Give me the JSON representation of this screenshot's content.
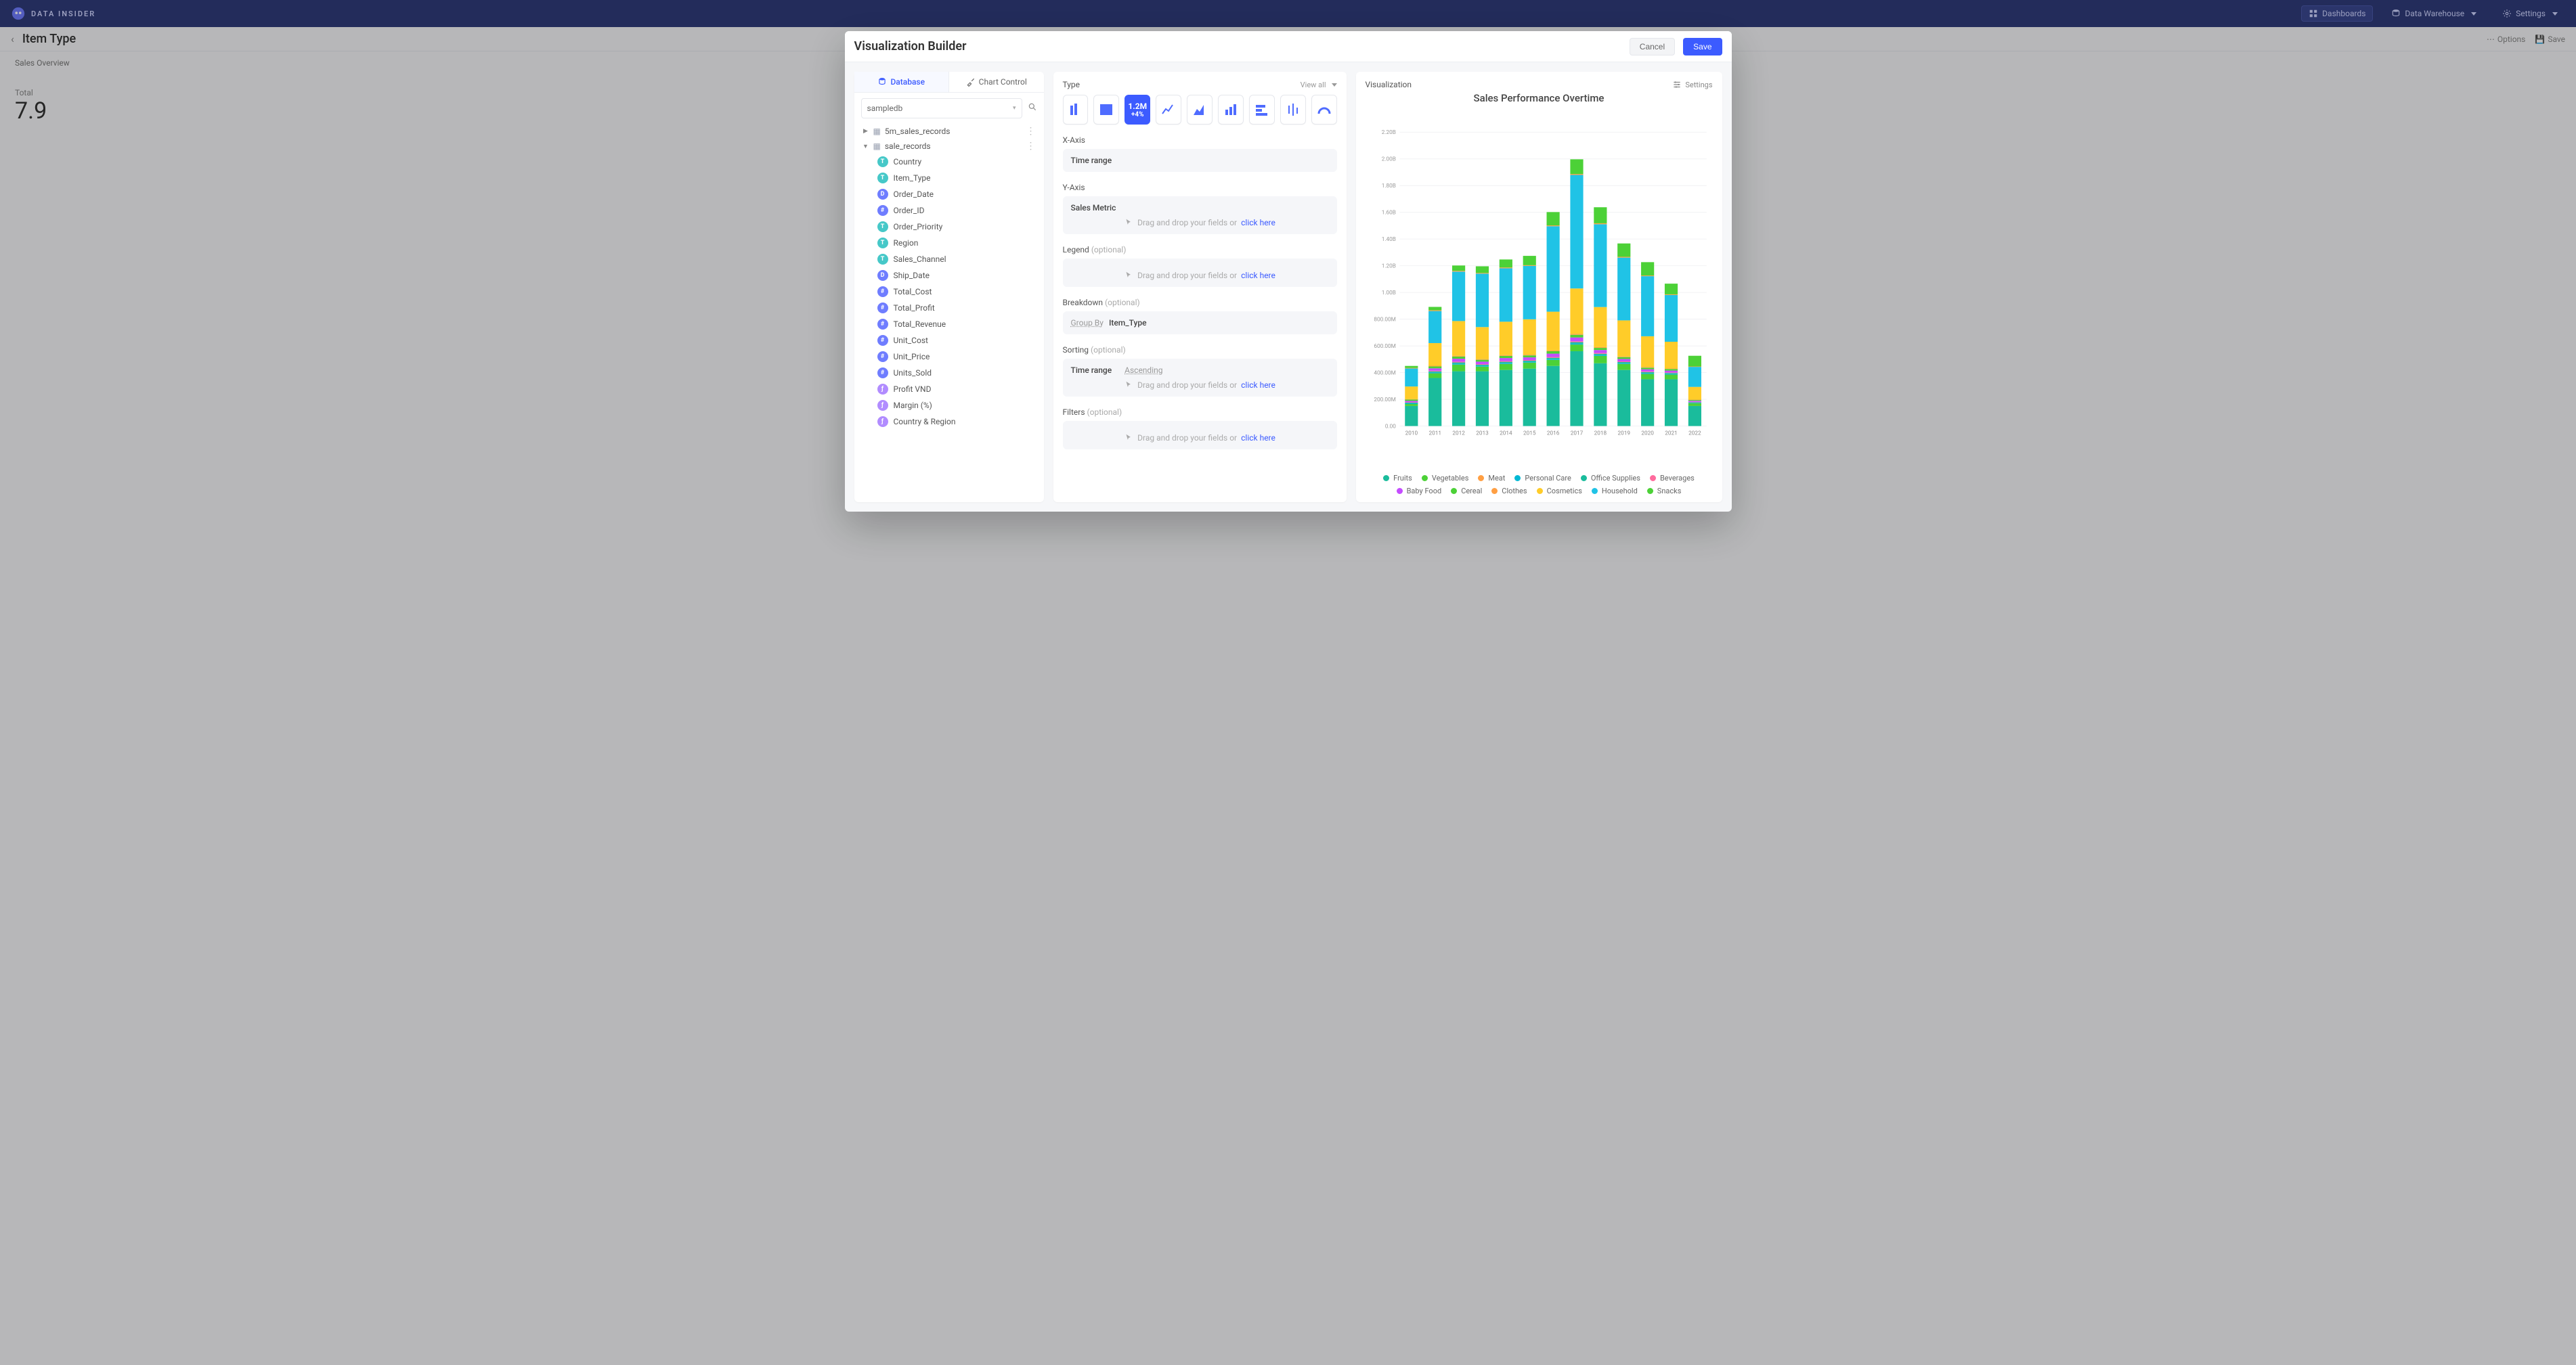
{
  "app": {
    "brand": "DATA INSIDER",
    "header_buttons": {
      "dashboards": "Dashboards",
      "warehouse": "Data Warehouse",
      "settings": "Settings"
    }
  },
  "page": {
    "back_breadcrumb": "Item Type",
    "tools": {
      "options": "Options",
      "save": "Save"
    },
    "side_tab": "Sales Overview",
    "bg_number_label": "Total",
    "bg_number": "7.9"
  },
  "modal": {
    "title": "Visualization Builder",
    "cancel": "Cancel",
    "save": "Save"
  },
  "left_panel": {
    "tabs": {
      "database": "Database",
      "chart_control": "Chart Control"
    },
    "db_selected": "sampledb",
    "tables": [
      {
        "id": "5m",
        "name": "5m_sales_records",
        "expanded": false
      },
      {
        "id": "sr",
        "name": "sale_records",
        "expanded": true
      }
    ],
    "columns": [
      {
        "type": "T",
        "name": "Country"
      },
      {
        "type": "T",
        "name": "Item_Type"
      },
      {
        "type": "D",
        "name": "Order_Date"
      },
      {
        "type": "I",
        "name": "Order_ID"
      },
      {
        "type": "T",
        "name": "Order_Priority"
      },
      {
        "type": "T",
        "name": "Region"
      },
      {
        "type": "T",
        "name": "Sales_Channel"
      },
      {
        "type": "D",
        "name": "Ship_Date"
      },
      {
        "type": "N",
        "name": "Total_Cost"
      },
      {
        "type": "N",
        "name": "Total_Profit"
      },
      {
        "type": "N",
        "name": "Total_Revenue"
      },
      {
        "type": "N",
        "name": "Unit_Cost"
      },
      {
        "type": "N",
        "name": "Unit_Price"
      },
      {
        "type": "N",
        "name": "Units_Sold"
      },
      {
        "type": "F",
        "name": "Profit VND"
      },
      {
        "type": "F",
        "name": "Margin (%)"
      },
      {
        "type": "F",
        "name": "Country & Region"
      }
    ]
  },
  "mid_panel": {
    "type_label": "Type",
    "view_all": "View all",
    "x_label": "X-Axis",
    "x_value": "Time range",
    "y_label": "Y-Axis",
    "y_value": "Sales Metric",
    "drag_text": "Drag and drop your fields or ",
    "click_here": "click here",
    "legend_label": "Legend",
    "optional": "(optional)",
    "breakdown_label": "Breakdown",
    "breakdown_key": "Group By",
    "breakdown_val": "Item_Type",
    "sorting_label": "Sorting",
    "sort_key": "Time range",
    "sort_dir": "Ascending",
    "filters_label": "Filters",
    "selected_kpi_big": "1.2M",
    "selected_kpi_small": "+4%"
  },
  "viz": {
    "heading": "Visualization",
    "settings": "Settings",
    "chart_title": "Sales Performance Overtime"
  },
  "chart_data": {
    "type": "bar",
    "title": "Sales Performance Overtime",
    "ylabel": "",
    "xlabel": "",
    "ylim": [
      0,
      2200000000.0
    ],
    "y_ticks": [
      0,
      200000000.0,
      400000000.0,
      600000000.0,
      800000000.0,
      1000000000.0,
      1200000000.0,
      1400000000.0,
      1600000000.0,
      1800000000.0,
      2000000000.0,
      2200000000.0
    ],
    "y_tick_labels": [
      "0.00",
      "200.00M",
      "400.00M",
      "600.00M",
      "800.00M",
      "1.00B",
      "1.20B",
      "1.40B",
      "1.60B",
      "1.80B",
      "2.00B",
      "2.20B"
    ],
    "categories": [
      "2010",
      "2011",
      "2012",
      "2013",
      "2014",
      "2015",
      "2016",
      "2017",
      "2018",
      "2019",
      "2020",
      "2021",
      "2022"
    ],
    "series": [
      {
        "name": "Fruits",
        "color": "#1abc9c",
        "values": [
          150000000.0,
          360000000.0,
          410000000.0,
          410000000.0,
          420000000.0,
          430000000.0,
          450000000.0,
          560000000.0,
          470000000.0,
          420000000.0,
          350000000.0,
          350000000.0,
          150000000.0
        ]
      },
      {
        "name": "Vegetables",
        "color": "#4cd137",
        "values": [
          15000000.0,
          35000000.0,
          50000000.0,
          35000000.0,
          45000000.0,
          45000000.0,
          45000000.0,
          50000000.0,
          55000000.0,
          45000000.0,
          40000000.0,
          35000000.0,
          20000000.0
        ]
      },
      {
        "name": "Meat",
        "color": "#ff9f43",
        "values": [
          4000000.0,
          6000000.0,
          6000000.0,
          5000000.0,
          6000000.0,
          5000000.0,
          6000000.0,
          7000000.0,
          7000000.0,
          6000000.0,
          5000000.0,
          5000000.0,
          3000000.0
        ]
      },
      {
        "name": "Personal Care",
        "color": "#00b8d4",
        "values": [
          5000000.0,
          7000000.0,
          8000000.0,
          7000000.0,
          8000000.0,
          7000000.0,
          8000000.0,
          9000000.0,
          8000000.0,
          7000000.0,
          7000000.0,
          6000000.0,
          4000000.0
        ]
      },
      {
        "name": "Office Supplies",
        "color": "#1abc9c",
        "values": [
          5000000.0,
          7000000.0,
          8000000.0,
          7000000.0,
          8000000.0,
          7000000.0,
          8000000.0,
          9000000.0,
          8000000.0,
          7000000.0,
          7000000.0,
          6000000.0,
          4000000.0
        ]
      },
      {
        "name": "Beverages",
        "color": "#ff6b9d",
        "values": [
          3000000.0,
          5000000.0,
          6000000.0,
          5000000.0,
          6000000.0,
          5000000.0,
          6000000.0,
          7000000.0,
          6000000.0,
          5000000.0,
          5000000.0,
          4000000.0,
          3000000.0
        ]
      },
      {
        "name": "Baby Food",
        "color": "#c44cff",
        "values": [
          10000000.0,
          18000000.0,
          22000000.0,
          18000000.0,
          22000000.0,
          20000000.0,
          25000000.0,
          28000000.0,
          22000000.0,
          18000000.0,
          16000000.0,
          14000000.0,
          8000000.0
        ]
      },
      {
        "name": "Cereal",
        "color": "#4cd137",
        "values": [
          10000000.0,
          14000000.0,
          16000000.0,
          14000000.0,
          16000000.0,
          15000000.0,
          18000000.0,
          20000000.0,
          16000000.0,
          14000000.0,
          12000000.0,
          12000000.0,
          6000000.0
        ]
      },
      {
        "name": "Clothes",
        "color": "#ff9f43",
        "values": [
          3000000.0,
          5000000.0,
          6000000.0,
          5000000.0,
          6000000.0,
          5000000.0,
          6000000.0,
          7000000.0,
          6000000.0,
          5000000.0,
          5000000.0,
          4000000.0,
          3000000.0
        ]
      },
      {
        "name": "Cosmetics",
        "color": "#ffcc29",
        "values": [
          95000000.0,
          170000000.0,
          260000000.0,
          240000000.0,
          250000000.0,
          265000000.0,
          290000000.0,
          340000000.0,
          300000000.0,
          270000000.0,
          230000000.0,
          200000000.0,
          95000000.0
        ]
      },
      {
        "name": "Household",
        "color": "#20c3e6",
        "values": [
          135000000.0,
          240000000.0,
          370000000.0,
          400000000.0,
          400000000.0,
          400000000.0,
          640000000.0,
          850000000.0,
          620000000.0,
          470000000.0,
          450000000.0,
          350000000.0,
          150000000.0
        ]
      },
      {
        "name": "Snacks",
        "color": "#4cd137",
        "values": [
          15000000.0,
          25000000.0,
          40000000.0,
          50000000.0,
          60000000.0,
          70000000.0,
          100000000.0,
          110000000.0,
          120000000.0,
          100000000.0,
          100000000.0,
          80000000.0,
          80000000.0
        ]
      }
    ],
    "series_draw_top_to_bottom": [
      "Snacks",
      "Meat",
      "Household",
      "Cosmetics",
      "Clothes",
      "Cereal",
      "Baby Food",
      "Beverages",
      "Office Supplies",
      "Personal Care",
      "Vegetables",
      "Fruits"
    ]
  }
}
